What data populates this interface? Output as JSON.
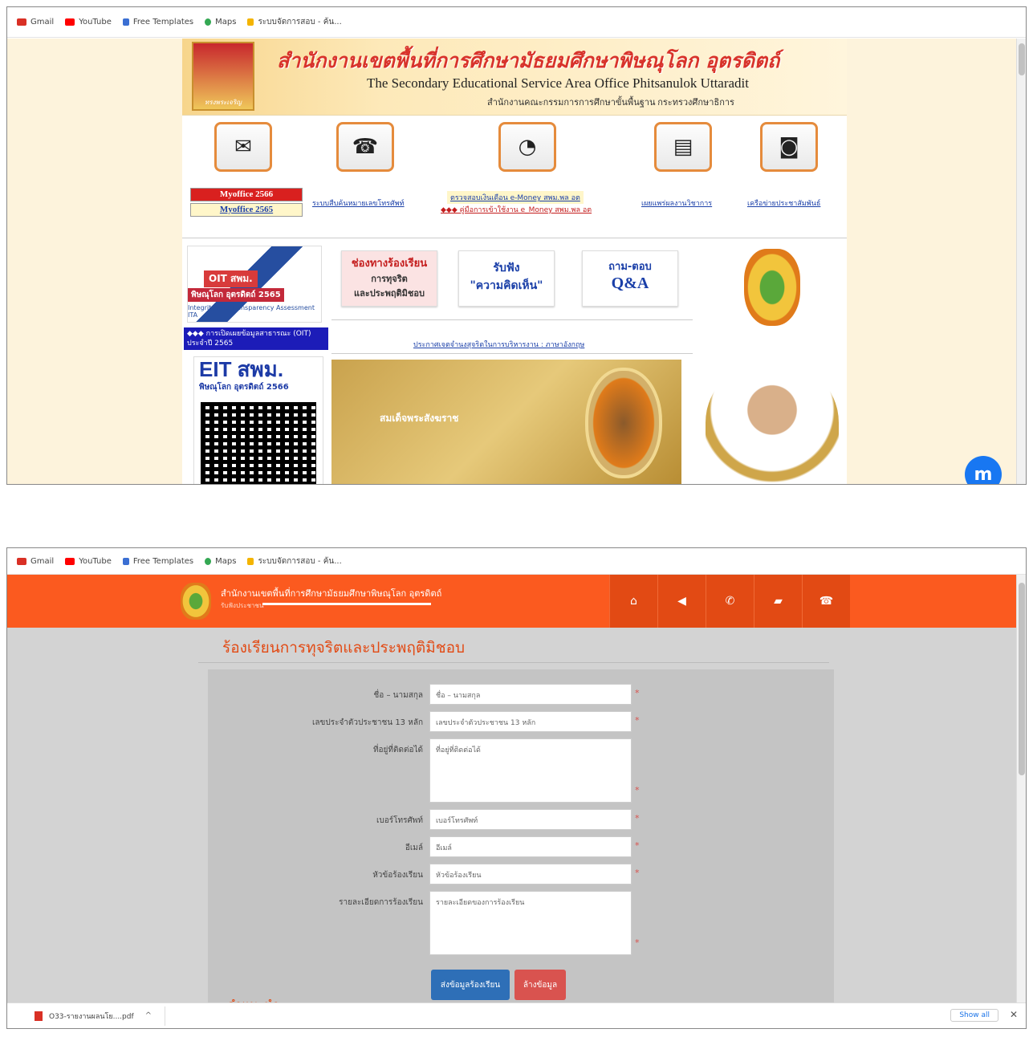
{
  "bookmarks": [
    {
      "label": "Gmail",
      "color": "#d93025"
    },
    {
      "label": "YouTube",
      "color": "#ff0000"
    },
    {
      "label": "Free Templates",
      "color": "#3b6fd3"
    },
    {
      "label": "Maps",
      "color": "#34a853"
    },
    {
      "label": "ระบบจัดการสอบ - ค้น...",
      "color": "#f4b400"
    }
  ],
  "site1": {
    "seal_caption": "ทรงพระเจริญ",
    "thai_title": "สำนักงานเขตพื้นที่การศึกษามัธยมศึกษาพิษณุโลก อุตรดิตถ์",
    "en_title": "The Secondary Educational Service Area Office Phitsanulok Uttaradit",
    "sub_title": "สำนักงานคณะกรรมการการศึกษาขั้นพื้นฐาน กระทรวงศึกษาธิการ",
    "myoffice_2566": "Myoffice 2566",
    "myoffice_2565": "Myoffice 2565",
    "link_phone": "ระบบสืบค้นหมายเลขโทรศัพท์",
    "link_money": "ตรวจสอบเงินเดือน e-Money สพม.พล อต",
    "link_manual": "◆◆◆ คู่มือการเข้าใช้งาน e_Money สพม.พล อต",
    "link_works": "เผยแพร่ผลงานวิชาการ",
    "link_pr": "เครือข่ายประชาสัมพันธ์",
    "oit_badge": "OIT สพม.",
    "oit_area": "พิษณุโลก อุตรดิตถ์ 2565",
    "ita_caption": "Integrity and Transparency Assessment ITA",
    "oit_disclosure": "◆◆◆ การเปิดเผยข้อมูลสาธารณะ (OIT) ประจำปี 2565",
    "complaint_1": "ช่องทางร้องเรียน",
    "complaint_2": "การทุจริต",
    "complaint_3": "และประพฤติมิชอบ",
    "listen_1": "รับฟัง",
    "listen_2": "\"ความคิดเห็น\"",
    "qa_1": "ถาม-ตอบ",
    "qa_2": "Q&A",
    "announce": "ประกาศเจตจำนงสุจริตในการบริหารงาน : ภาษาอังกฤษ",
    "eit_title": "EIT สพม.",
    "eit_sub": "พิษณุโลก อุตรดิตถ์ 2566",
    "memorial_text": "สมเด็จพระสังฆราช",
    "messenger": "m"
  },
  "site2": {
    "header_title": "สำนักงานเขตพื้นที่การศึกษามัธยมศึกษาพิษณุโลก อุตรดิตถ์",
    "header_sub": "รับฟังประชาชน",
    "nav": [
      "⌂",
      "◀",
      "✆",
      "▰",
      "☎"
    ],
    "form_title": "ร้องเรียนการทุจริตและประพฤติมิชอบ",
    "fields": [
      {
        "label": "ชื่อ – นามสกุล",
        "placeholder": "ชื่อ – นามสกุล"
      },
      {
        "label": "เลขประจำตัวประชาชน 13 หลัก",
        "placeholder": "เลขประจำตัวประชาชน 13 หลัก"
      },
      {
        "label": "ที่อยู่ที่ติดต่อได้",
        "placeholder": "ที่อยู่ที่ติดต่อได้"
      },
      {
        "label": "เบอร์โทรศัพท์",
        "placeholder": "เบอร์โทรศัพท์"
      },
      {
        "label": "อีเมล์",
        "placeholder": "อีเมล์"
      },
      {
        "label": "หัวข้อร้องเรียน",
        "placeholder": "หัวข้อร้องเรียน"
      },
      {
        "label": "รายละเอียดการร้องเรียน",
        "placeholder": "รายละเอียดของการร้องเรียน"
      }
    ],
    "required_mark": "*",
    "send_button": "ส่งข้อมูลร้องเรียน",
    "clear_button": "ล้างข้อมูล",
    "hint": "คำแนะนำ"
  },
  "downloads": {
    "file": "O33-รายงานผลนโย....pdf",
    "chevron": "^",
    "show_all": "Show all",
    "close": "✕"
  }
}
